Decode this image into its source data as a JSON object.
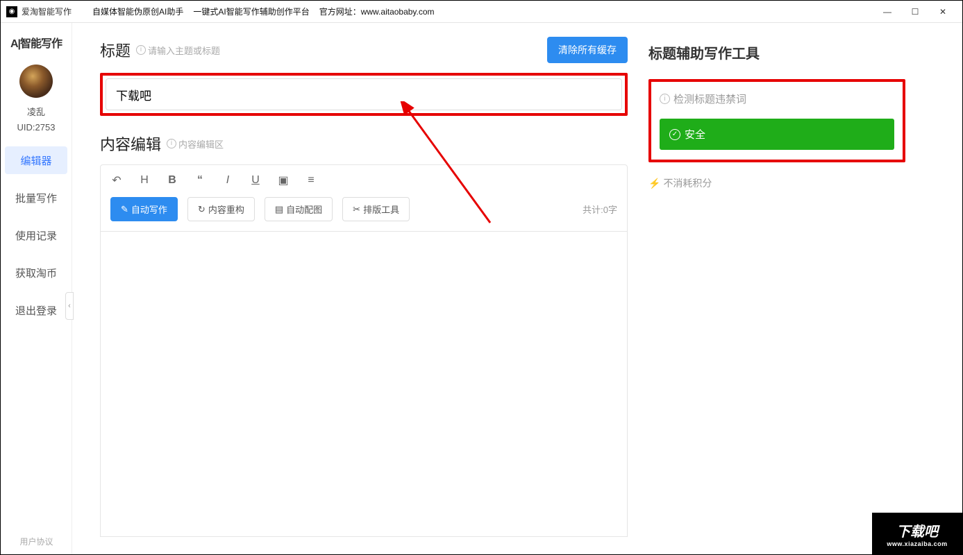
{
  "titlebar": {
    "app_name": "爱淘智能写作",
    "subtitle1": "自媒体智能伪原创AI助手",
    "subtitle2": "一键式AI智能写作辅助创作平台",
    "website_label": "官方网址：",
    "website_url": "www.aitaobaby.com"
  },
  "sidebar": {
    "logo": "A|智能写作",
    "username": "凌乱",
    "uid": "UID:2753",
    "nav": [
      "编辑器",
      "批量写作",
      "使用记录",
      "获取淘币",
      "退出登录"
    ],
    "footer": "用户协议"
  },
  "editor": {
    "title_label": "标题",
    "title_hint": "请输入主题或标题",
    "clear_cache": "清除所有缓存",
    "title_value": "下载吧",
    "content_label": "内容编辑",
    "content_hint": "内容编辑区",
    "actions": {
      "auto_write": "自动写作",
      "rebuild": "内容重构",
      "auto_image": "自动配图",
      "layout_tool": "排版工具"
    },
    "word_count": "共计:0字"
  },
  "right": {
    "title": "标题辅助写作工具",
    "check_label": "检测标题违禁词",
    "safe_text": "安全",
    "no_cost": "不消耗积分"
  },
  "watermark": {
    "text": "下载吧",
    "url": "www.xiazaiba.com"
  }
}
